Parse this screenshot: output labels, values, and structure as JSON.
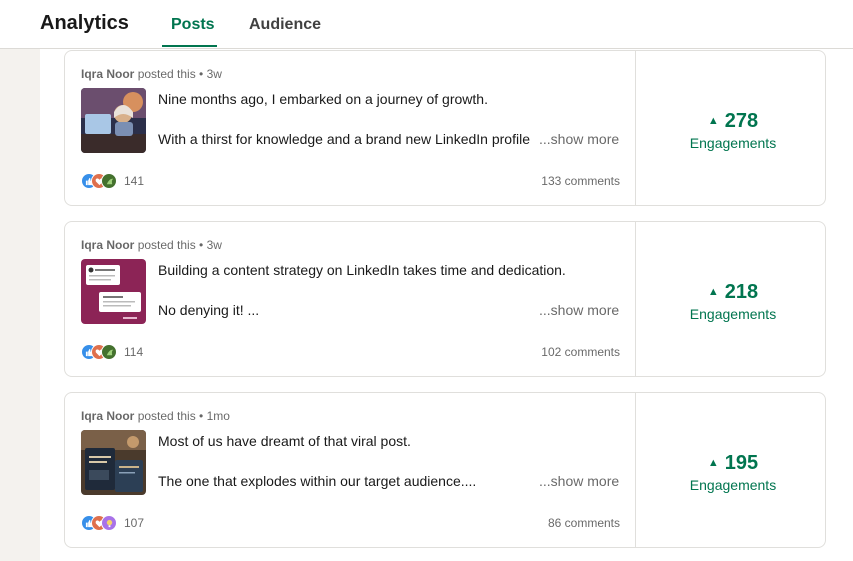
{
  "header": {
    "title": "Analytics",
    "tabs": [
      {
        "label": "Posts",
        "active": true
      },
      {
        "label": "Audience",
        "active": false
      }
    ],
    "accent_color": "#01754f"
  },
  "posts": [
    {
      "author": "Iqra Noor",
      "posted_text": "posted this • 3w",
      "line1": "Nine months ago, I embarked on a journey of growth.",
      "line2": "With a thirst for knowledge and a brand new LinkedIn profile",
      "show_more": "...show more",
      "reaction_icons": [
        "like-icon",
        "love-icon",
        "support-icon"
      ],
      "reaction_count": "141",
      "comments": "133 comments",
      "engagements_value": "278",
      "engagements_label": "Engagements"
    },
    {
      "author": "Iqra Noor",
      "posted_text": "posted this • 3w",
      "line1": "Building a content strategy on LinkedIn takes time and dedication.",
      "line2": "No denying it! ...",
      "show_more": "...show more",
      "reaction_icons": [
        "like-icon",
        "love-icon",
        "support-icon"
      ],
      "reaction_count": "114",
      "comments": "102 comments",
      "engagements_value": "218",
      "engagements_label": "Engagements"
    },
    {
      "author": "Iqra Noor",
      "posted_text": "posted this • 1mo",
      "line1": "Most of us have dreamt of that viral post.",
      "line2": "The one that explodes within our target audience....",
      "show_more": "...show more",
      "reaction_icons": [
        "like-icon",
        "love-icon",
        "insightful-icon"
      ],
      "reaction_count": "107",
      "comments": "86 comments",
      "engagements_value": "195",
      "engagements_label": "Engagements"
    }
  ]
}
